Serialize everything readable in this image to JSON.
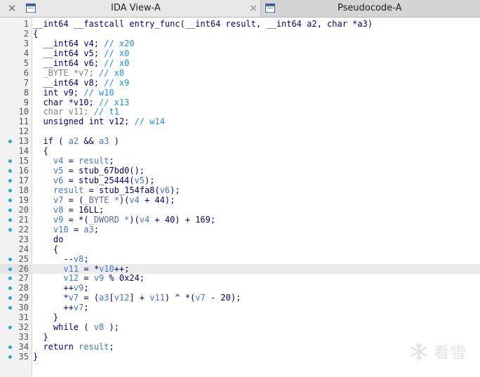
{
  "tabs": [
    {
      "label": "IDA View-A",
      "active": true,
      "close_glyph": "✕",
      "icon": "listing-window-icon"
    },
    {
      "label": "Pseudocode-A",
      "active": false,
      "close_glyph": "✕",
      "icon": "listing-window-icon"
    }
  ],
  "watermark": {
    "text": "看雪",
    "icon": "snowflake-icon"
  },
  "code": {
    "current_line": 26,
    "lines": [
      {
        "n": "1",
        "bp": false,
        "tokens": [
          [
            "k",
            "__int64 __fastcall entry_func(__int64 result, __int64 a2, char *a3)"
          ]
        ]
      },
      {
        "n": "2",
        "bp": false,
        "tokens": [
          [
            "k",
            "{"
          ]
        ]
      },
      {
        "n": "3",
        "bp": false,
        "tokens": [
          [
            "k",
            "  __int64 v4; "
          ],
          [
            "c",
            "// x20"
          ]
        ]
      },
      {
        "n": "4",
        "bp": false,
        "tokens": [
          [
            "k",
            "  __int64 v5; "
          ],
          [
            "c",
            "// x0"
          ]
        ]
      },
      {
        "n": "5",
        "bp": false,
        "tokens": [
          [
            "k",
            "  __int64 v6; "
          ],
          [
            "c",
            "// x0"
          ]
        ]
      },
      {
        "n": "6",
        "bp": false,
        "tokens": [
          [
            "g",
            "  _BYTE *v7; "
          ],
          [
            "c",
            "// x8"
          ]
        ]
      },
      {
        "n": "7",
        "bp": false,
        "tokens": [
          [
            "k",
            "  __int64 v8; "
          ],
          [
            "c",
            "// x9"
          ]
        ]
      },
      {
        "n": "8",
        "bp": false,
        "tokens": [
          [
            "k",
            "  int v9; "
          ],
          [
            "c",
            "// w10"
          ]
        ]
      },
      {
        "n": "9",
        "bp": false,
        "tokens": [
          [
            "k",
            "  char *v10; "
          ],
          [
            "c",
            "// x13"
          ]
        ]
      },
      {
        "n": "10",
        "bp": false,
        "tokens": [
          [
            "g",
            "  char v11; "
          ],
          [
            "c",
            "// t1"
          ]
        ]
      },
      {
        "n": "11",
        "bp": false,
        "tokens": [
          [
            "k",
            "  unsigned int v12; "
          ],
          [
            "c",
            "// w14"
          ]
        ]
      },
      {
        "n": "12",
        "bp": false,
        "tokens": [
          [
            "k",
            ""
          ]
        ]
      },
      {
        "n": "13",
        "bp": true,
        "tokens": [
          [
            "k",
            "  if ( "
          ],
          [
            "v",
            "a2"
          ],
          [
            "k",
            " && "
          ],
          [
            "v",
            "a3"
          ],
          [
            "k",
            " )"
          ]
        ]
      },
      {
        "n": "14",
        "bp": false,
        "tokens": [
          [
            "k",
            "  {"
          ]
        ]
      },
      {
        "n": "15",
        "bp": true,
        "tokens": [
          [
            "k",
            "    "
          ],
          [
            "v",
            "v4"
          ],
          [
            "k",
            " = "
          ],
          [
            "v",
            "result"
          ],
          [
            "k",
            ";"
          ]
        ]
      },
      {
        "n": "16",
        "bp": true,
        "tokens": [
          [
            "k",
            "    "
          ],
          [
            "v",
            "v5"
          ],
          [
            "k",
            " = stub_67bd0();"
          ]
        ]
      },
      {
        "n": "17",
        "bp": true,
        "tokens": [
          [
            "k",
            "    "
          ],
          [
            "v",
            "v6"
          ],
          [
            "k",
            " = stub_25444("
          ],
          [
            "v",
            "v5"
          ],
          [
            "k",
            ");"
          ]
        ]
      },
      {
        "n": "18",
        "bp": true,
        "tokens": [
          [
            "k",
            "    "
          ],
          [
            "v",
            "result"
          ],
          [
            "k",
            " = stub_154fa8("
          ],
          [
            "v",
            "v6"
          ],
          [
            "k",
            ");"
          ]
        ]
      },
      {
        "n": "19",
        "bp": true,
        "tokens": [
          [
            "k",
            "    "
          ],
          [
            "v",
            "v7"
          ],
          [
            "k",
            " = ("
          ],
          [
            "m",
            "_BYTE *"
          ],
          [
            "k",
            ")("
          ],
          [
            "v",
            "v4"
          ],
          [
            "k",
            " + 44);"
          ]
        ]
      },
      {
        "n": "20",
        "bp": true,
        "tokens": [
          [
            "k",
            "    "
          ],
          [
            "v",
            "v8"
          ],
          [
            "k",
            " = 16LL;"
          ]
        ]
      },
      {
        "n": "21",
        "bp": true,
        "tokens": [
          [
            "k",
            "    "
          ],
          [
            "v",
            "v9"
          ],
          [
            "k",
            " = *("
          ],
          [
            "m",
            "_DWORD *"
          ],
          [
            "k",
            ")("
          ],
          [
            "v",
            "v4"
          ],
          [
            "k",
            " + 40) + 169;"
          ]
        ]
      },
      {
        "n": "22",
        "bp": true,
        "tokens": [
          [
            "k",
            "    "
          ],
          [
            "v",
            "v10"
          ],
          [
            "k",
            " = "
          ],
          [
            "v",
            "a3"
          ],
          [
            "k",
            ";"
          ]
        ]
      },
      {
        "n": "23",
        "bp": false,
        "tokens": [
          [
            "k",
            "    do"
          ]
        ]
      },
      {
        "n": "24",
        "bp": false,
        "tokens": [
          [
            "k",
            "    {"
          ]
        ]
      },
      {
        "n": "25",
        "bp": true,
        "tokens": [
          [
            "k",
            "      --"
          ],
          [
            "v",
            "v8"
          ],
          [
            "k",
            ";"
          ]
        ]
      },
      {
        "n": "26",
        "bp": true,
        "tokens": [
          [
            "k",
            "      "
          ],
          [
            "v",
            "v11"
          ],
          [
            "k",
            " = *"
          ],
          [
            "v",
            "v10"
          ],
          [
            "k",
            "++;"
          ]
        ]
      },
      {
        "n": "27",
        "bp": true,
        "tokens": [
          [
            "k",
            "      "
          ],
          [
            "v",
            "v12"
          ],
          [
            "k",
            " = "
          ],
          [
            "v",
            "v9"
          ],
          [
            "k",
            " % 0x24;"
          ]
        ]
      },
      {
        "n": "28",
        "bp": true,
        "tokens": [
          [
            "k",
            "      ++"
          ],
          [
            "v",
            "v9"
          ],
          [
            "k",
            ";"
          ]
        ]
      },
      {
        "n": "29",
        "bp": true,
        "tokens": [
          [
            "k",
            "      *"
          ],
          [
            "v",
            "v7"
          ],
          [
            "k",
            " = ("
          ],
          [
            "v",
            "a3"
          ],
          [
            "k",
            "["
          ],
          [
            "v",
            "v12"
          ],
          [
            "k",
            "] + "
          ],
          [
            "v",
            "v11"
          ],
          [
            "k",
            ") ^ *("
          ],
          [
            "v",
            "v7"
          ],
          [
            "k",
            " - 20);"
          ]
        ]
      },
      {
        "n": "30",
        "bp": true,
        "tokens": [
          [
            "k",
            "      ++"
          ],
          [
            "v",
            "v7"
          ],
          [
            "k",
            ";"
          ]
        ]
      },
      {
        "n": "31",
        "bp": false,
        "tokens": [
          [
            "k",
            "    }"
          ]
        ]
      },
      {
        "n": "32",
        "bp": true,
        "tokens": [
          [
            "k",
            "    while ( "
          ],
          [
            "v",
            "v8"
          ],
          [
            "k",
            " );"
          ]
        ]
      },
      {
        "n": "33",
        "bp": false,
        "tokens": [
          [
            "k",
            "  }"
          ]
        ]
      },
      {
        "n": "34",
        "bp": true,
        "tokens": [
          [
            "k",
            "  return "
          ],
          [
            "v",
            "result"
          ],
          [
            "k",
            ";"
          ]
        ]
      },
      {
        "n": "35",
        "bp": true,
        "tokens": [
          [
            "k",
            "}"
          ]
        ]
      }
    ]
  }
}
